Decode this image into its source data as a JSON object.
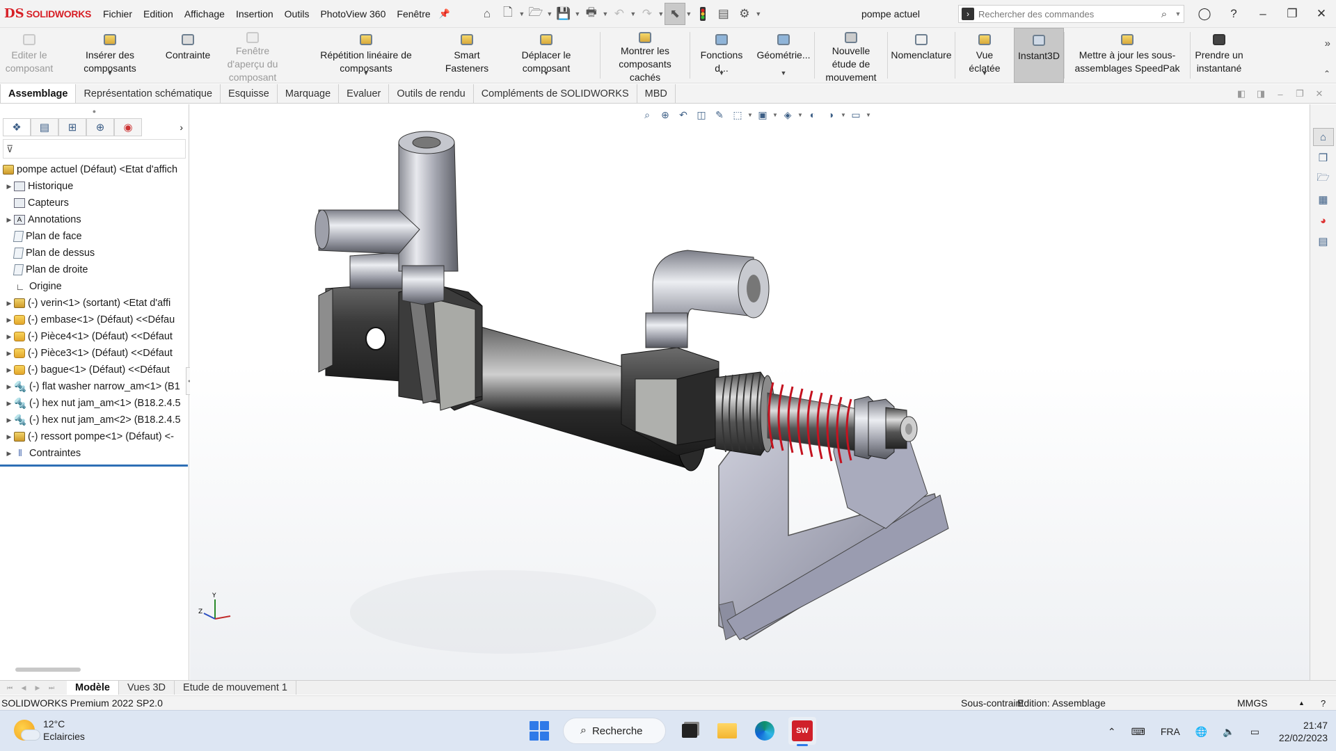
{
  "app": {
    "brand": "SOLIDWORKS",
    "logo_mark": "DS",
    "document_title": "pompe actuel"
  },
  "menu": [
    "Fichier",
    "Edition",
    "Affichage",
    "Insertion",
    "Outils",
    "PhotoView 360",
    "Fenêtre"
  ],
  "search": {
    "placeholder": "Rechercher des commandes"
  },
  "ribbon": [
    {
      "label": "Editer le composant",
      "disabled": true,
      "icon": "edit-component-icon"
    },
    {
      "label": "Insérer des composants",
      "disabled": false,
      "icon": "insert-components-icon"
    },
    {
      "label": "Contrainte",
      "disabled": false,
      "icon": "mate-icon"
    },
    {
      "label": "Fenêtre d'aperçu du composant",
      "disabled": true,
      "icon": "preview-window-icon"
    },
    {
      "label": "Répétition linéaire de composants",
      "disabled": false,
      "icon": "linear-pattern-icon"
    },
    {
      "label": "Smart Fasteners",
      "disabled": false,
      "icon": "smart-fasteners-icon"
    },
    {
      "label": "Déplacer le composant",
      "disabled": false,
      "icon": "move-component-icon"
    },
    {
      "label": "Montrer les composants cachés",
      "disabled": false,
      "icon": "show-hidden-icon"
    },
    {
      "label": "Fonctions d...",
      "disabled": false,
      "icon": "features-icon"
    },
    {
      "label": "Géométrie...",
      "disabled": false,
      "icon": "reference-geometry-icon"
    },
    {
      "label": "Nouvelle étude de mouvement",
      "disabled": false,
      "icon": "motion-study-icon"
    },
    {
      "label": "Nomenclature",
      "disabled": false,
      "icon": "bom-icon"
    },
    {
      "label": "Vue éclatée",
      "disabled": false,
      "icon": "exploded-view-icon"
    },
    {
      "label": "Instant3D",
      "disabled": false,
      "icon": "instant3d-icon",
      "active": true
    },
    {
      "label": "Mettre à jour les sous-assemblages SpeedPak",
      "disabled": false,
      "icon": "speedpak-icon"
    },
    {
      "label": "Prendre un instantané",
      "disabled": false,
      "icon": "camera-icon"
    }
  ],
  "tabs": [
    "Assemblage",
    "Représentation schématique",
    "Esquisse",
    "Marquage",
    "Evaluer",
    "Outils de rendu",
    "Compléments de SOLIDWORKS",
    "MBD"
  ],
  "tree": {
    "root": "pompe actuel (Défaut) <Etat d'affich",
    "items": [
      {
        "label": "Historique",
        "icon": "history-icon",
        "expand": true
      },
      {
        "label": "Capteurs",
        "icon": "sensors-icon",
        "expand": false
      },
      {
        "label": "Annotations",
        "icon": "annotations-icon",
        "expand": true
      },
      {
        "label": "Plan de face",
        "icon": "plane-icon",
        "expand": false
      },
      {
        "label": "Plan de dessus",
        "icon": "plane-icon",
        "expand": false
      },
      {
        "label": "Plan de droite",
        "icon": "plane-icon",
        "expand": false
      },
      {
        "label": "Origine",
        "icon": "origin-icon",
        "expand": false
      },
      {
        "label": "(-) verin<1> (sortant) <Etat d'affi",
        "icon": "part-icon",
        "expand": true
      },
      {
        "label": "(-) embase<1> (Défaut) <<Défau",
        "icon": "part-icon",
        "expand": true
      },
      {
        "label": "(-) Pièce4<1> (Défaut) <<Défaut",
        "icon": "part-icon",
        "expand": true
      },
      {
        "label": "(-) Pièce3<1> (Défaut) <<Défaut",
        "icon": "part-icon",
        "expand": true
      },
      {
        "label": "(-) bague<1> (Défaut) <<Défaut",
        "icon": "part-icon",
        "expand": true
      },
      {
        "label": "(-) flat washer narrow_am<1> (B1",
        "icon": "fastener-icon",
        "expand": true
      },
      {
        "label": "(-) hex nut jam_am<1> (B18.2.4.5",
        "icon": "fastener-icon",
        "expand": true
      },
      {
        "label": "(-) hex nut jam_am<2> (B18.2.4.5",
        "icon": "fastener-icon",
        "expand": true
      },
      {
        "label": "(-) ressort pompe<1> (Défaut) <-",
        "icon": "part-icon",
        "expand": true
      },
      {
        "label": "Contraintes",
        "icon": "mates-icon",
        "expand": true
      }
    ]
  },
  "bottom_tabs": [
    "Modèle",
    "Vues 3D",
    "Etude de mouvement 1"
  ],
  "status": {
    "left": "SOLIDWORKS Premium 2022 SP2.0",
    "constraint": "Sous-contraint",
    "editing": "Edition: Assemblage",
    "units": "MMGS"
  },
  "taskbar": {
    "weather_temp": "12°C",
    "weather_desc": "Eclaircies",
    "search_label": "Recherche",
    "lang": "FRA",
    "time": "21:47",
    "date": "22/02/2023"
  },
  "triad": {
    "y": "Y",
    "z": "Z"
  }
}
